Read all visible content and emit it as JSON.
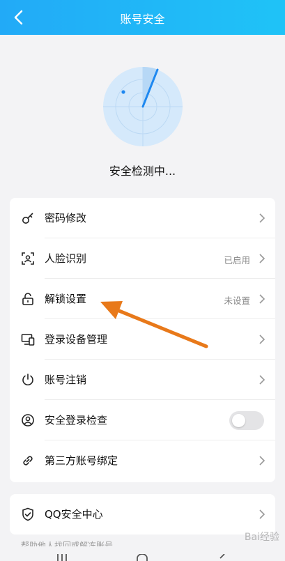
{
  "header": {
    "title": "账号安全"
  },
  "scan": {
    "status": "安全检测中..."
  },
  "menu": [
    {
      "label": "密码修改",
      "icon": "key-icon",
      "value": ""
    },
    {
      "label": "人脸识别",
      "icon": "face-scan-icon",
      "value": "已启用"
    },
    {
      "label": "解锁设置",
      "icon": "unlock-icon",
      "value": "未设置"
    },
    {
      "label": "登录设备管理",
      "icon": "device-icon",
      "value": ""
    },
    {
      "label": "账号注销",
      "icon": "power-icon",
      "value": ""
    },
    {
      "label": "安全登录检查",
      "icon": "user-circle-icon",
      "toggle": false
    },
    {
      "label": "第三方账号绑定",
      "icon": "link-icon",
      "value": ""
    }
  ],
  "qq": {
    "label": "QQ安全中心",
    "icon": "shield-icon"
  },
  "footer": {
    "help": "帮助他人找回或解冻账号"
  },
  "watermark": "Bai经验",
  "colors": {
    "header_start": "#22aaf7",
    "header_end": "#1fc3f7",
    "accent": "#1e90ff",
    "arrow": "#e8791a"
  }
}
